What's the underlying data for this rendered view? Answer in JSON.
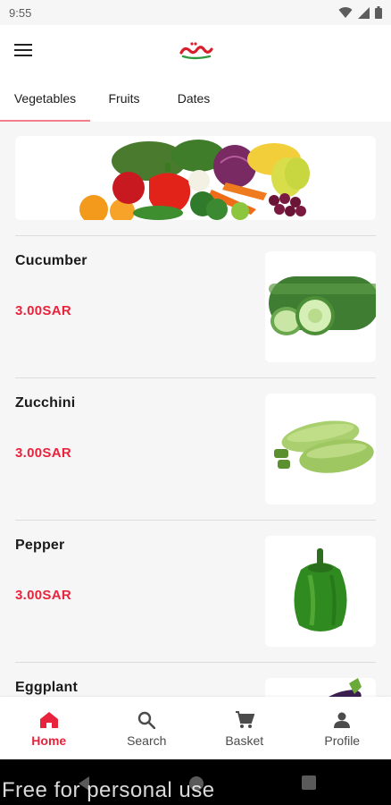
{
  "status_bar": {
    "time": "9:55"
  },
  "tabs": [
    {
      "label": "Vegetables"
    },
    {
      "label": "Fruits"
    },
    {
      "label": "Dates"
    }
  ],
  "products": [
    {
      "name": "Cucumber",
      "price": "3.00SAR"
    },
    {
      "name": "Zucchini",
      "price": "3.00SAR"
    },
    {
      "name": "Pepper",
      "price": "3.00SAR"
    },
    {
      "name": "Eggplant",
      "price": ""
    }
  ],
  "bottom_nav": [
    {
      "label": "Home",
      "icon": "home-icon"
    },
    {
      "label": "Search",
      "icon": "search-icon"
    },
    {
      "label": "Basket",
      "icon": "cart-icon"
    },
    {
      "label": "Profile",
      "icon": "person-icon"
    }
  ],
  "watermark": "Free for personal use",
  "colors": {
    "accent": "#e8233c",
    "tab_indicator": "#f27f8b",
    "background": "#f6f6f6"
  }
}
